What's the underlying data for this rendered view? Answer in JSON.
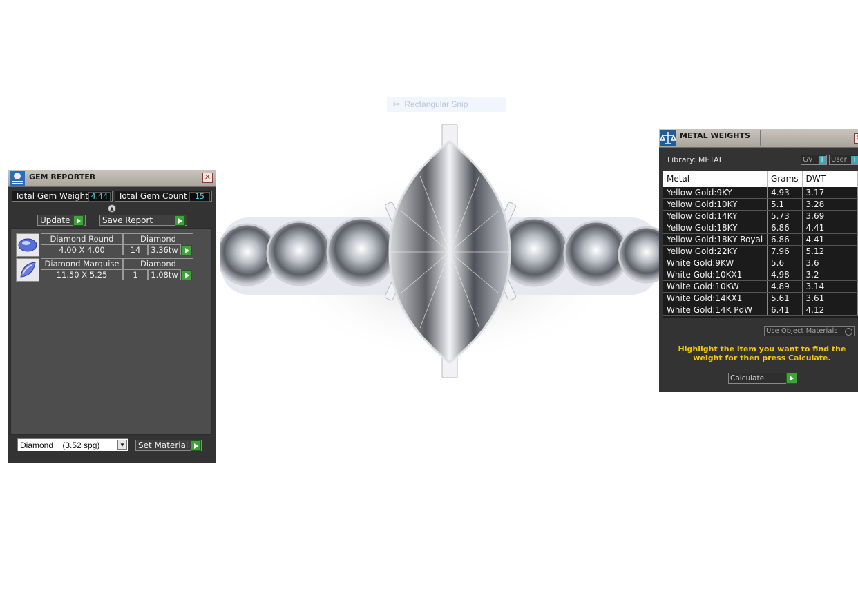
{
  "snip_tool": {
    "label": "Rectangular Snip",
    "icon": "scissors-icon"
  },
  "gem_reporter": {
    "title": "GEM REPORTER",
    "icon": "gem-reporter-app-icon",
    "total_gem_weight_label": "Total Gem Weight",
    "total_gem_weight_value": "4.44",
    "total_gem_count_label": "Total Gem Count",
    "total_gem_count_value": "15",
    "update_label": "Update",
    "save_report_label": "Save Report",
    "gems": [
      {
        "name": "Diamond Round",
        "material": "Diamond",
        "size": "4.00 X 4.00",
        "count": "14",
        "weight": "3.36tw",
        "icon": "round-gem-icon"
      },
      {
        "name": "Diamond Marquise",
        "material": "Diamond",
        "size": "11.50 X 5.25",
        "count": "1",
        "weight": "1.08tw",
        "icon": "marquise-gem-icon"
      }
    ],
    "material_select": "Diamond    (3.52 spg)",
    "set_material_label": "Set Material"
  },
  "metal_weights": {
    "title": "METAL WEIGHTS",
    "icon": "scale-icon",
    "library": "Library: METAL",
    "toggles": [
      "GV",
      "User"
    ],
    "columns": [
      "Metal",
      "Grams",
      "DWT"
    ],
    "rows": [
      [
        "Yellow Gold:9KY",
        "4.93",
        "3.17"
      ],
      [
        "Yellow Gold:10KY",
        "5.1",
        "3.28"
      ],
      [
        "Yellow Gold:14KY",
        "5.73",
        "3.69"
      ],
      [
        "Yellow Gold:18KY",
        "6.86",
        "4.41"
      ],
      [
        "Yellow Gold:18KY Royal",
        "6.86",
        "4.41"
      ],
      [
        "Yellow Gold:22KY",
        "7.96",
        "5.12"
      ],
      [
        "White Gold:9KW",
        "5.6",
        "3.6"
      ],
      [
        "White Gold:10KX1",
        "4.98",
        "3.2"
      ],
      [
        "White Gold:10KW",
        "4.89",
        "3.14"
      ],
      [
        "White Gold:14KX1",
        "5.61",
        "3.61"
      ],
      [
        "White Gold:14K PdW",
        "6.41",
        "4.12"
      ]
    ],
    "use_object_materials": "Use Object Materials",
    "hint": "Highlight the item you want to find the weight for then press Calculate.",
    "calculate_label": "Calculate"
  }
}
